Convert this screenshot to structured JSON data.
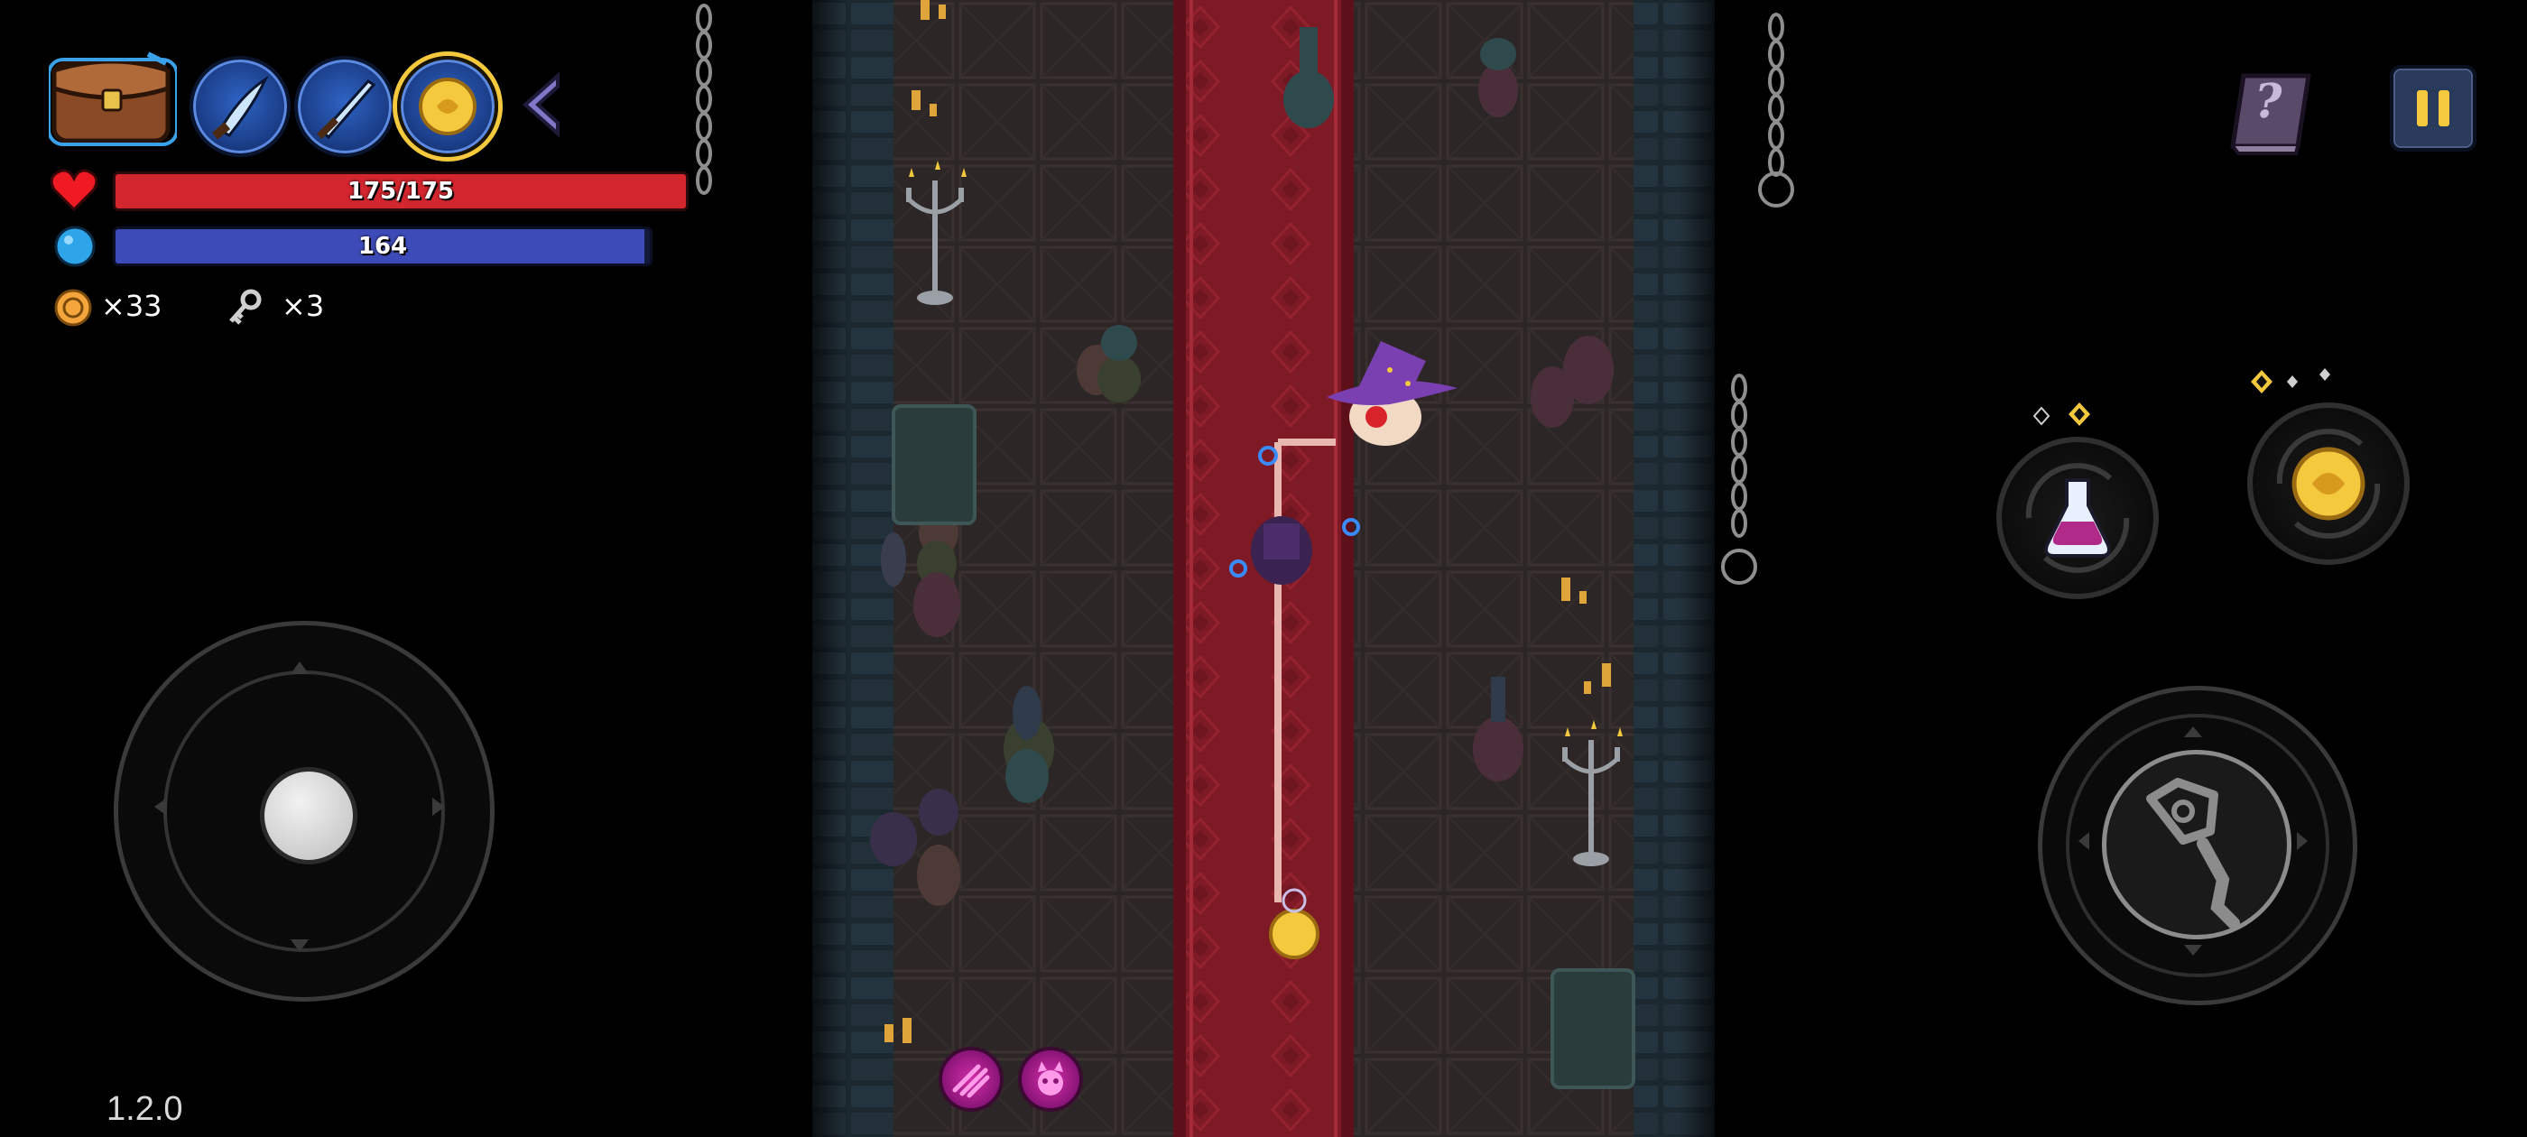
{
  "hud": {
    "bag_icon": "leather-satchel-icon",
    "weapon_slots": [
      {
        "icon": "curved-dagger-icon",
        "active": false
      },
      {
        "icon": "blue-sword-icon",
        "active": false
      },
      {
        "icon": "golden-orb-staff-icon",
        "active": true
      }
    ],
    "collapse_icon": "chevron-left-icon",
    "health": {
      "text": "175/175",
      "current": 175,
      "max": 175,
      "color": "#d3262e"
    },
    "mana": {
      "text": "164",
      "fill_fraction": 0.99,
      "color": "#3d4bb8"
    },
    "coins": {
      "text": "×33",
      "icon": "coin-icon"
    },
    "keys": {
      "text": "×3",
      "icon": "key-icon"
    }
  },
  "top_right": {
    "help_book_text": "?",
    "help_book_icon": "help-book-icon",
    "pause_icon": "pause-icon"
  },
  "skills": {
    "potion": {
      "icon": "potion-swap-icon"
    },
    "weapon_swap": {
      "icon": "orb-swap-icon"
    },
    "attack": {
      "icon": "staff-attack-icon"
    }
  },
  "buffs": [
    {
      "icon": "speed-buff-icon"
    },
    {
      "icon": "demon-buff-icon"
    }
  ],
  "version": "1.2.0",
  "colors": {
    "carpet": "#7a1722",
    "floor": "#2c2525",
    "wall": "#1c2a33",
    "gold": "#f4c93d"
  }
}
